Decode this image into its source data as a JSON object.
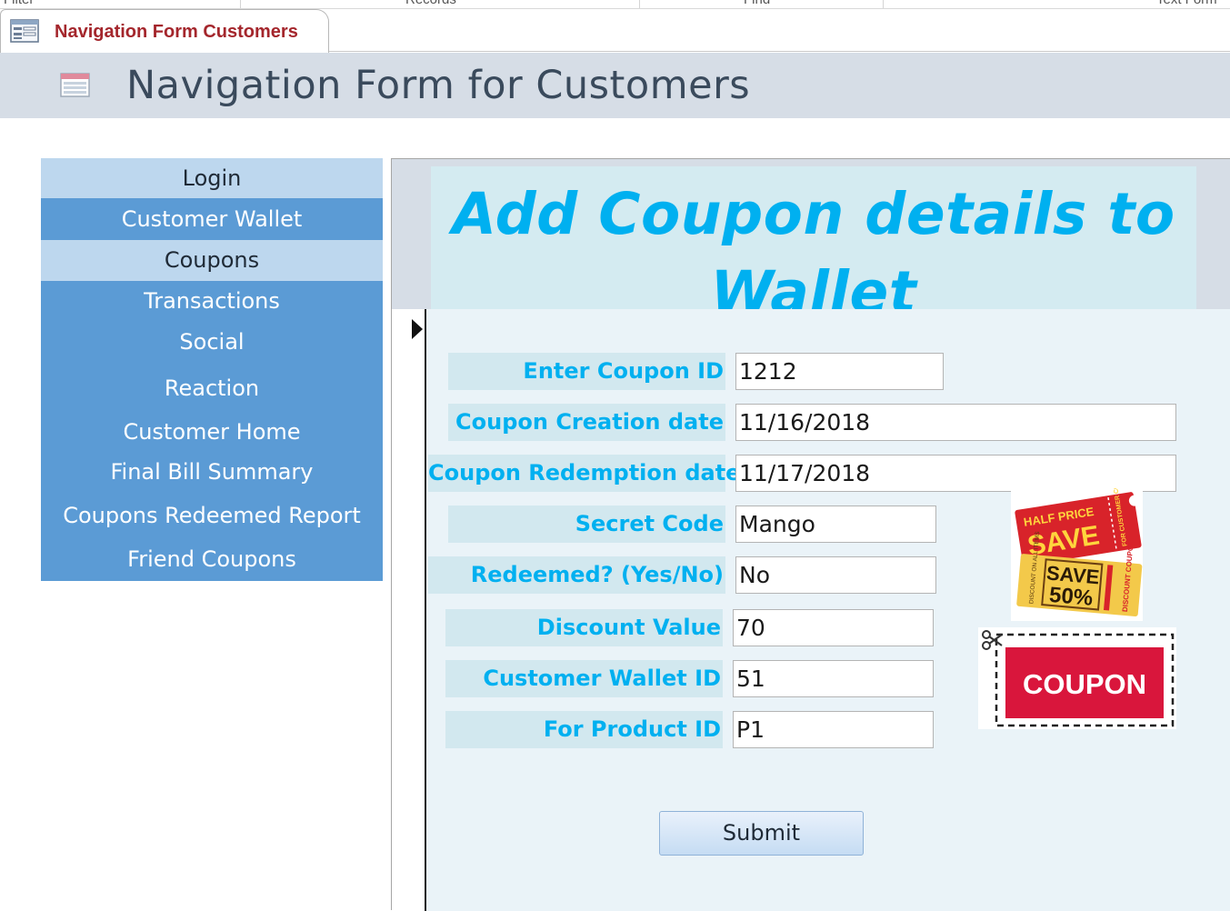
{
  "top_strip": {
    "items": [
      "Filter",
      "Records",
      "Find",
      "Text Form"
    ]
  },
  "document_tab": {
    "title": "Navigation Form Customers"
  },
  "form_header": {
    "title": "Navigation Form for Customers"
  },
  "navigation": {
    "items": [
      {
        "label": "Login"
      },
      {
        "label": "Customer Wallet"
      },
      {
        "label": "Coupons"
      },
      {
        "label": "Transactions"
      },
      {
        "label": "Social"
      },
      {
        "label": "Reaction"
      },
      {
        "label": "Customer Home"
      },
      {
        "label": "Final Bill Summary"
      },
      {
        "label": "Coupons Redeemed Report"
      },
      {
        "label": "Friend Coupons"
      }
    ]
  },
  "subform": {
    "title_line1": "Add Coupon details to",
    "title_line2": "Wallet",
    "fields": [
      {
        "label": "Enter Coupon ID",
        "value": "1212"
      },
      {
        "label": "Coupon Creation date",
        "value": "11/16/2018"
      },
      {
        "label": "Coupon Redemption date",
        "value": "11/17/2018"
      },
      {
        "label": "Secret Code",
        "value": "Mango"
      },
      {
        "label": "Redeemed? (Yes/No)",
        "value": "No"
      },
      {
        "label": "Discount Value",
        "value": "70"
      },
      {
        "label": "Customer Wallet ID",
        "value": "51"
      },
      {
        "label": "For Product ID",
        "value": "P1"
      }
    ],
    "submit_label": "Submit"
  },
  "images": {
    "half_price": {
      "line1": "HALF PRICE",
      "line2": "SAVE",
      "side": "FOR CUSTOMER COUPON",
      "small": "DISCOUNT ON ALL ITEMS"
    },
    "save_50": {
      "line1": "SAVE",
      "line2": "50%",
      "side": "DISCOUNT COUPON"
    },
    "coupon": {
      "label": "COUPON"
    }
  },
  "colors": {
    "nav_active": "#5b9bd5",
    "nav_light": "#bdd7ee",
    "label_text": "#00b0f0",
    "tab_title": "#a4262c",
    "coupon_red": "#d9163c"
  }
}
